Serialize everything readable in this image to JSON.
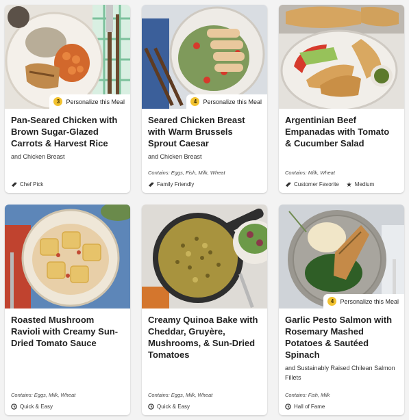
{
  "cards": [
    {
      "title": "Pan-Seared Chicken with Brown Sugar-Glazed Carrots & Harvest Rice",
      "subtitle": "and Chicken Breast",
      "contains": "",
      "badge": {
        "count": "3",
        "label": "Personalize this Meal"
      },
      "tags": [
        {
          "icon": "chef-hat-icon",
          "label": "Chef Pick"
        }
      ]
    },
    {
      "title": "Seared Chicken Breast with Warm Brussels Sprout Caesar",
      "subtitle": "and Chicken Breast",
      "contains": "Contains: Eggs, Fish, Milk, Wheat",
      "badge": {
        "count": "4",
        "label": "Personalize this Meal"
      },
      "tags": [
        {
          "icon": "family-icon",
          "label": "Family Friendly"
        }
      ]
    },
    {
      "title": "Argentinian Beef Empanadas with Tomato & Cucumber Salad",
      "subtitle": "",
      "contains": "Contains: Milk, Wheat",
      "badge": null,
      "tags": [
        {
          "icon": "heart-icon",
          "label": "Customer Favorite"
        },
        {
          "icon": "chili-icon",
          "label": "Medium"
        }
      ]
    },
    {
      "title": "Roasted Mushroom Ravioli with Creamy Sun-Dried Tomato Sauce",
      "subtitle": "",
      "contains": "Contains: Eggs, Milk, Wheat",
      "badge": null,
      "tags": [
        {
          "icon": "clock-icon",
          "label": "Quick & Easy"
        }
      ]
    },
    {
      "title": "Creamy Quinoa Bake with Cheddar, Gruyère, Mushrooms, & Sun-Dried Tomatoes",
      "subtitle": "",
      "contains": "Contains: Eggs, Milk, Wheat",
      "badge": null,
      "tags": [
        {
          "icon": "clock-icon",
          "label": "Quick & Easy"
        }
      ]
    },
    {
      "title": "Garlic Pesto Salmon with Rosemary Mashed Potatoes & Sautéed Spinach",
      "subtitle": "and Sustainably Raised Chilean Salmon Fillets",
      "contains": "Contains: Fish, Milk",
      "badge": {
        "count": "4",
        "label": "Personalize this Meal"
      },
      "tags": [
        {
          "icon": "trophy-icon",
          "label": "Hall of Fame"
        }
      ]
    }
  ]
}
